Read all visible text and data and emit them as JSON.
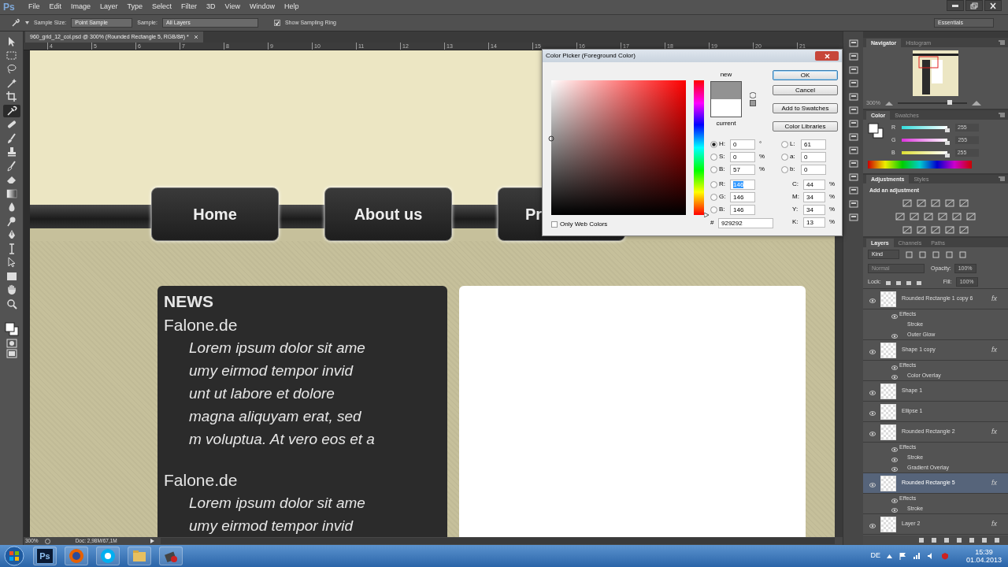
{
  "app": {
    "logo": "Ps"
  },
  "menu": [
    "File",
    "Edit",
    "Image",
    "Layer",
    "Type",
    "Select",
    "Filter",
    "3D",
    "View",
    "Window",
    "Help"
  ],
  "options_bar": {
    "sample_size_label": "Sample Size:",
    "sample_size": "Point Sample",
    "sample_label": "Sample:",
    "sample": "All Layers",
    "sampling_ring": {
      "label": "Show Sampling Ring",
      "checked": true
    },
    "workspace": "Essentials"
  },
  "tools": [
    {
      "kind": "move",
      "selected": false
    },
    {
      "kind": "marquee",
      "selected": false
    },
    {
      "kind": "lasso",
      "selected": false
    },
    {
      "kind": "wand",
      "selected": false
    },
    {
      "kind": "crop",
      "selected": false
    },
    {
      "kind": "eyedropper",
      "selected": true
    },
    {
      "kind": "heal",
      "selected": false
    },
    {
      "kind": "brush",
      "selected": false
    },
    {
      "kind": "stamp",
      "selected": false
    },
    {
      "kind": "history",
      "selected": false
    },
    {
      "kind": "eraser",
      "selected": false
    },
    {
      "kind": "gradient",
      "selected": false
    },
    {
      "kind": "blur",
      "selected": false
    },
    {
      "kind": "dodge",
      "selected": false
    },
    {
      "kind": "pen",
      "selected": false
    },
    {
      "kind": "type",
      "selected": false
    },
    {
      "kind": "path",
      "selected": false
    },
    {
      "kind": "shape",
      "selected": false
    },
    {
      "kind": "hand",
      "selected": false
    },
    {
      "kind": "zoom",
      "selected": false
    }
  ],
  "document": {
    "tab": "960_grid_12_col.psd @ 300% (Rounded Rectangle 5, RGB/8#) *",
    "ruler": [
      "4",
      "5",
      "6",
      "7",
      "8",
      "9",
      "10",
      "11",
      "12",
      "13",
      "14",
      "15",
      "16",
      "17",
      "18",
      "19",
      "20",
      "21"
    ],
    "canvas": {
      "nav": [
        {
          "label": "Home"
        },
        {
          "label": "About us"
        },
        {
          "label": "Pr"
        }
      ],
      "news": {
        "heading": "NEWS",
        "entries": [
          {
            "title": "Falone.de",
            "lines": [
              "Lorem ipsum dolor sit ame",
              "umy eirmod tempor invid",
              "unt ut labore et dolore",
              "magna aliquyam erat, sed",
              "m voluptua. At vero eos et a"
            ]
          },
          {
            "title": "Falone.de",
            "lines": [
              "Lorem ipsum dolor sit ame",
              "umy eirmod tempor invid"
            ]
          }
        ]
      }
    }
  },
  "status_bar": {
    "zoom": "300%",
    "doc": "Doc: 2,98M/67,1M"
  },
  "color_picker": {
    "title": "Color Picker (Foreground Color)",
    "swatches": [
      {
        "label": "new",
        "color": "#929292"
      },
      {
        "label": "current",
        "color": "#ffffff"
      }
    ],
    "buttons": [
      {
        "label": "OK",
        "default": true
      },
      {
        "label": "Cancel",
        "default": false
      },
      {
        "label": "Add to Swatches",
        "default": false
      },
      {
        "label": "Color Libraries",
        "default": false
      }
    ],
    "fields_left": [
      {
        "label": "H:",
        "value": "0",
        "unit": "°",
        "selected": true,
        "highlighted": false
      },
      {
        "label": "S:",
        "value": "0",
        "unit": "%",
        "selected": false,
        "highlighted": false
      },
      {
        "label": "B:",
        "value": "57",
        "unit": "%",
        "selected": false,
        "highlighted": false
      },
      {
        "label": "R:",
        "value": "146",
        "selected": false,
        "highlighted": true
      },
      {
        "label": "G:",
        "value": "146",
        "selected": false,
        "highlighted": false
      },
      {
        "label": "B:",
        "value": "146",
        "selected": false,
        "highlighted": false
      }
    ],
    "fields_lab": [
      {
        "label": "L:",
        "value": "61",
        "selected": false
      },
      {
        "label": "a:",
        "value": "0",
        "selected": false
      },
      {
        "label": "b:",
        "value": "0",
        "selected": false
      }
    ],
    "fields_cmyk": [
      {
        "label": "C:",
        "value": "44",
        "unit": "%"
      },
      {
        "label": "M:",
        "value": "34",
        "unit": "%"
      },
      {
        "label": "Y:",
        "value": "34",
        "unit": "%"
      },
      {
        "label": "K:",
        "value": "13",
        "unit": "%"
      }
    ],
    "hex": {
      "label": "#",
      "value": "929292"
    },
    "hue_slider": {
      "level": 0
    },
    "web_colors": {
      "label": "Only Web Colors",
      "checked": false
    }
  },
  "panels": {
    "navigator": {
      "tabs": [
        {
          "label": "Navigator",
          "selected": true
        },
        {
          "label": "Histogram",
          "selected": false
        }
      ],
      "zoom": "300%",
      "zoom_slider": {
        "level": 0.75
      }
    },
    "color": {
      "tabs": [
        {
          "label": "Color",
          "selected": true
        },
        {
          "label": "Swatches",
          "selected": false
        }
      ],
      "channels": [
        {
          "label": "R",
          "value": "255",
          "level": 1
        },
        {
          "label": "G",
          "value": "255",
          "level": 1
        },
        {
          "label": "B",
          "value": "255",
          "level": 1
        }
      ]
    },
    "adjustments": {
      "tabs": [
        {
          "label": "Adjustments",
          "selected": true
        },
        {
          "label": "Styles",
          "selected": false
        }
      ],
      "title": "Add an adjustment"
    },
    "layers": {
      "tabs": [
        {
          "label": "Layers",
          "selected": true
        },
        {
          "label": "Channels",
          "selected": false
        },
        {
          "label": "Paths",
          "selected": false
        }
      ],
      "filter": "Kind",
      "blend_mode": "Normal",
      "opacity_label": "Opacity:",
      "opacity": "100%",
      "lock_label": "Lock:",
      "fill_label": "Fill:",
      "fill": "100%",
      "items": [
        {
          "name": "Rounded Rectangle 1 copy 6",
          "visible": true,
          "selected": false,
          "fx": "fx",
          "children": [
            {
              "name": "Effects",
              "visible": true,
              "children": [
                {
                  "name": "Stroke",
                  "visible": false
                },
                {
                  "name": "Outer Glow",
                  "visible": true
                }
              ]
            }
          ]
        },
        {
          "name": "Shape 1 copy",
          "visible": true,
          "selected": false,
          "fx": "fx",
          "children": [
            {
              "name": "Effects",
              "visible": true,
              "children": [
                {
                  "name": "Color Overlay",
                  "visible": true
                }
              ]
            }
          ]
        },
        {
          "name": "Shape 1",
          "visible": true,
          "selected": false
        },
        {
          "name": "Ellipse 1",
          "visible": true,
          "selected": false
        },
        {
          "name": "Rounded Rectangle 2",
          "visible": true,
          "selected": false,
          "fx": "fx",
          "children": [
            {
              "name": "Effects",
              "visible": true,
              "children": [
                {
                  "name": "Stroke",
                  "visible": true
                },
                {
                  "name": "Gradient Overlay",
                  "visible": true
                }
              ]
            }
          ]
        },
        {
          "name": "Rounded Rectangle 5",
          "visible": true,
          "selected": true,
          "fx": "fx",
          "children": [
            {
              "name": "Effects",
              "visible": true,
              "children": [
                {
                  "name": "Stroke",
                  "visible": true
                }
              ]
            }
          ]
        },
        {
          "name": "Layer 2",
          "visible": true,
          "selected": false,
          "fx": "fx"
        }
      ]
    }
  },
  "taskbar": {
    "apps": [
      {
        "kind": "photoshop",
        "label": "Ps"
      },
      {
        "kind": "firefox"
      },
      {
        "kind": "skype"
      },
      {
        "kind": "explorer"
      },
      {
        "kind": "tool"
      }
    ],
    "language": "DE",
    "time": "15:39",
    "date": "01.04.2013"
  }
}
